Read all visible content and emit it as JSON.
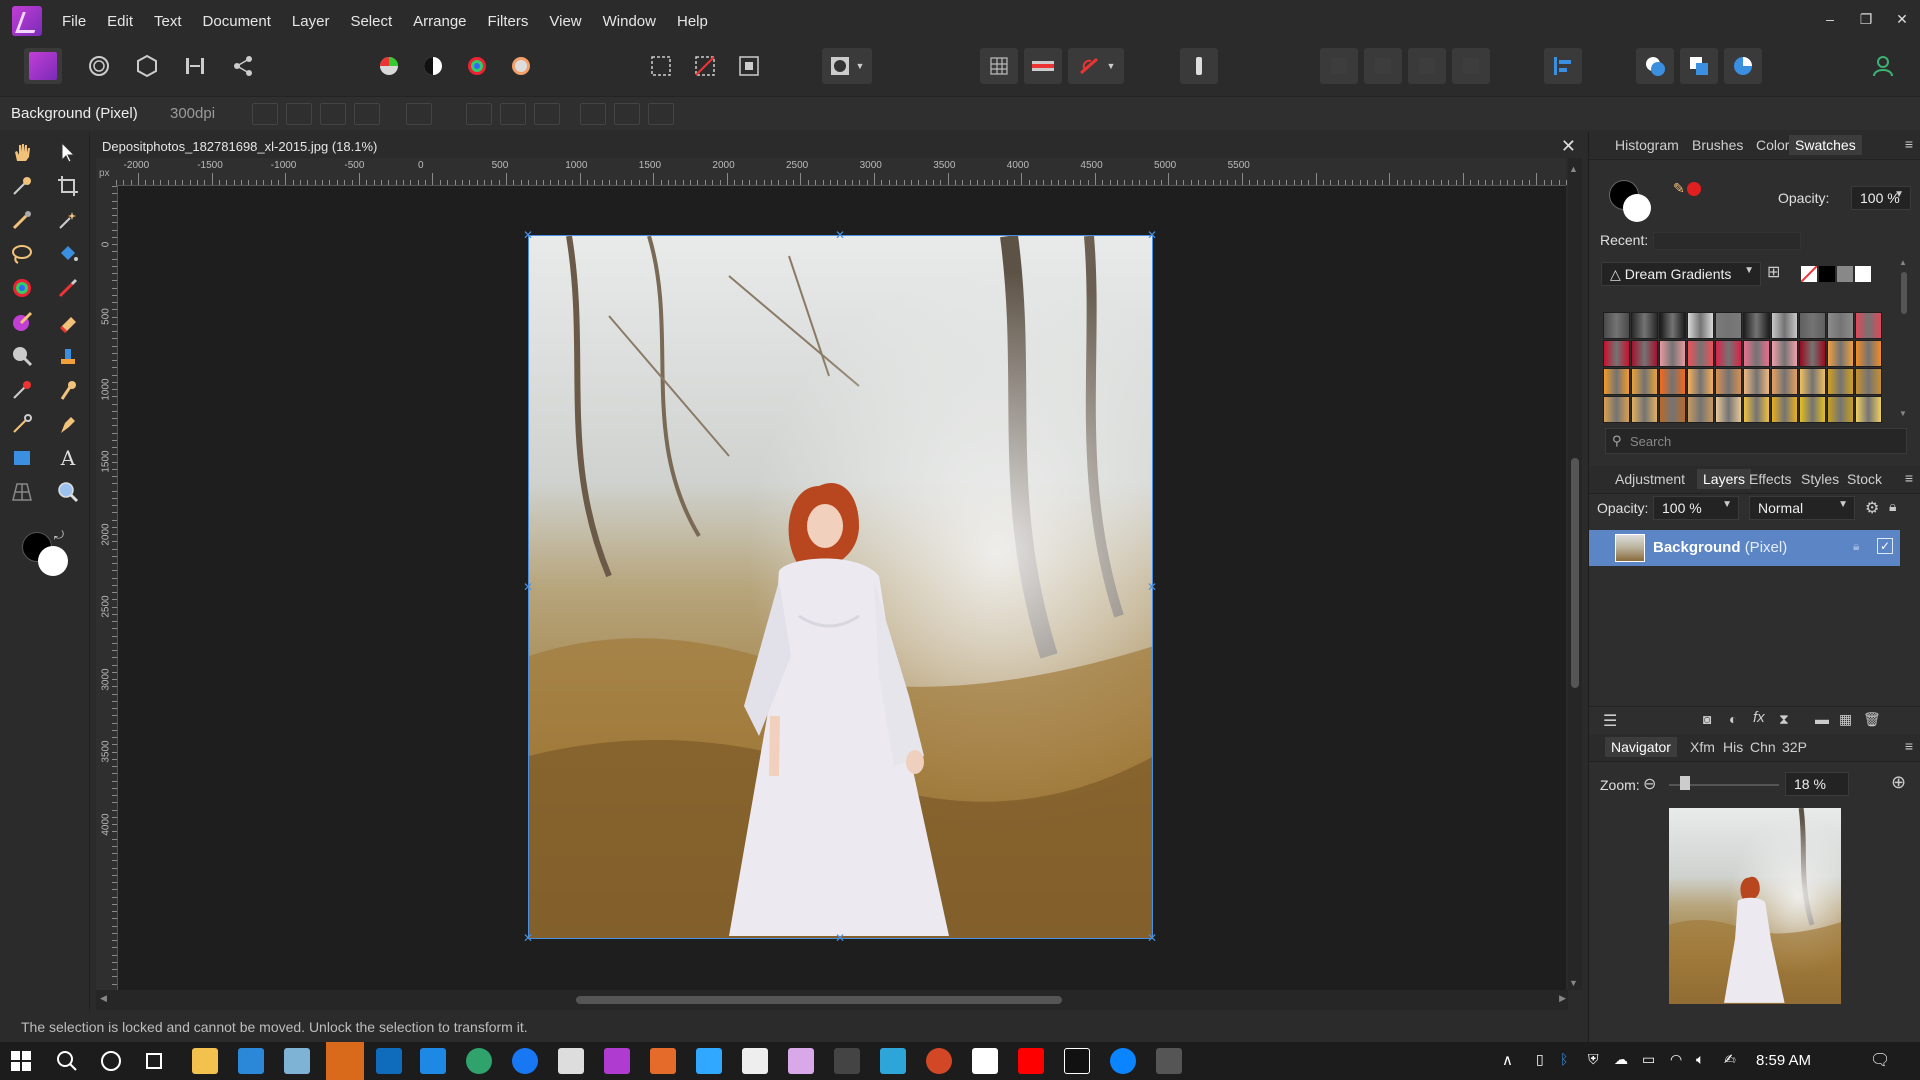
{
  "menu": [
    "File",
    "Edit",
    "Text",
    "Document",
    "Layer",
    "Select",
    "Arrange",
    "Filters",
    "View",
    "Window",
    "Help"
  ],
  "window_controls": [
    "–",
    "❐",
    "✕"
  ],
  "context": {
    "layer": "Background (Pixel)",
    "dpi": "300dpi"
  },
  "document": {
    "title": "Depositphotos_182781698_xl-2015.jpg (18.1%)",
    "ruler_unit": "px",
    "h_ticks": [
      "-2000",
      "-1500",
      "-1000",
      "-500",
      "0",
      "500",
      "1000",
      "1500",
      "2000",
      "2500",
      "3000",
      "3500",
      "4000",
      "4500",
      "5000",
      "5500"
    ],
    "v_ticks": [
      "0",
      "500",
      "1000",
      "1500",
      "2000",
      "2500",
      "3000",
      "3500",
      "4000"
    ]
  },
  "status": "The selection is locked and cannot be moved. Unlock the selection to transform it.",
  "color_panel": {
    "tabs": [
      "Histogram",
      "Brushes",
      "Color",
      "Swatches"
    ],
    "active_tab": "Swatches",
    "opacity_label": "Opacity:",
    "opacity_value": "100 %",
    "recent_label": "Recent:",
    "palette": "Dream Gradients",
    "search_placeholder": "Search",
    "accent_color": "#e02020"
  },
  "layers_panel": {
    "tabs": [
      "Adjustment",
      "Layers",
      "Effects",
      "Styles",
      "Stock"
    ],
    "active_tab": "Layers",
    "opacity_label": "Opacity:",
    "opacity_value": "100 %",
    "blend_mode": "Normal",
    "layer_name": "Background",
    "layer_type": "(Pixel)"
  },
  "navigator_panel": {
    "tabs": [
      "Navigator",
      "Xfm",
      "His",
      "Chn",
      "32P"
    ],
    "active_tab": "Navigator",
    "zoom_label": "Zoom:",
    "zoom_value": "18 %",
    "zoom_fraction": 0.18
  },
  "taskbar": {
    "time": "8:59 AM"
  }
}
